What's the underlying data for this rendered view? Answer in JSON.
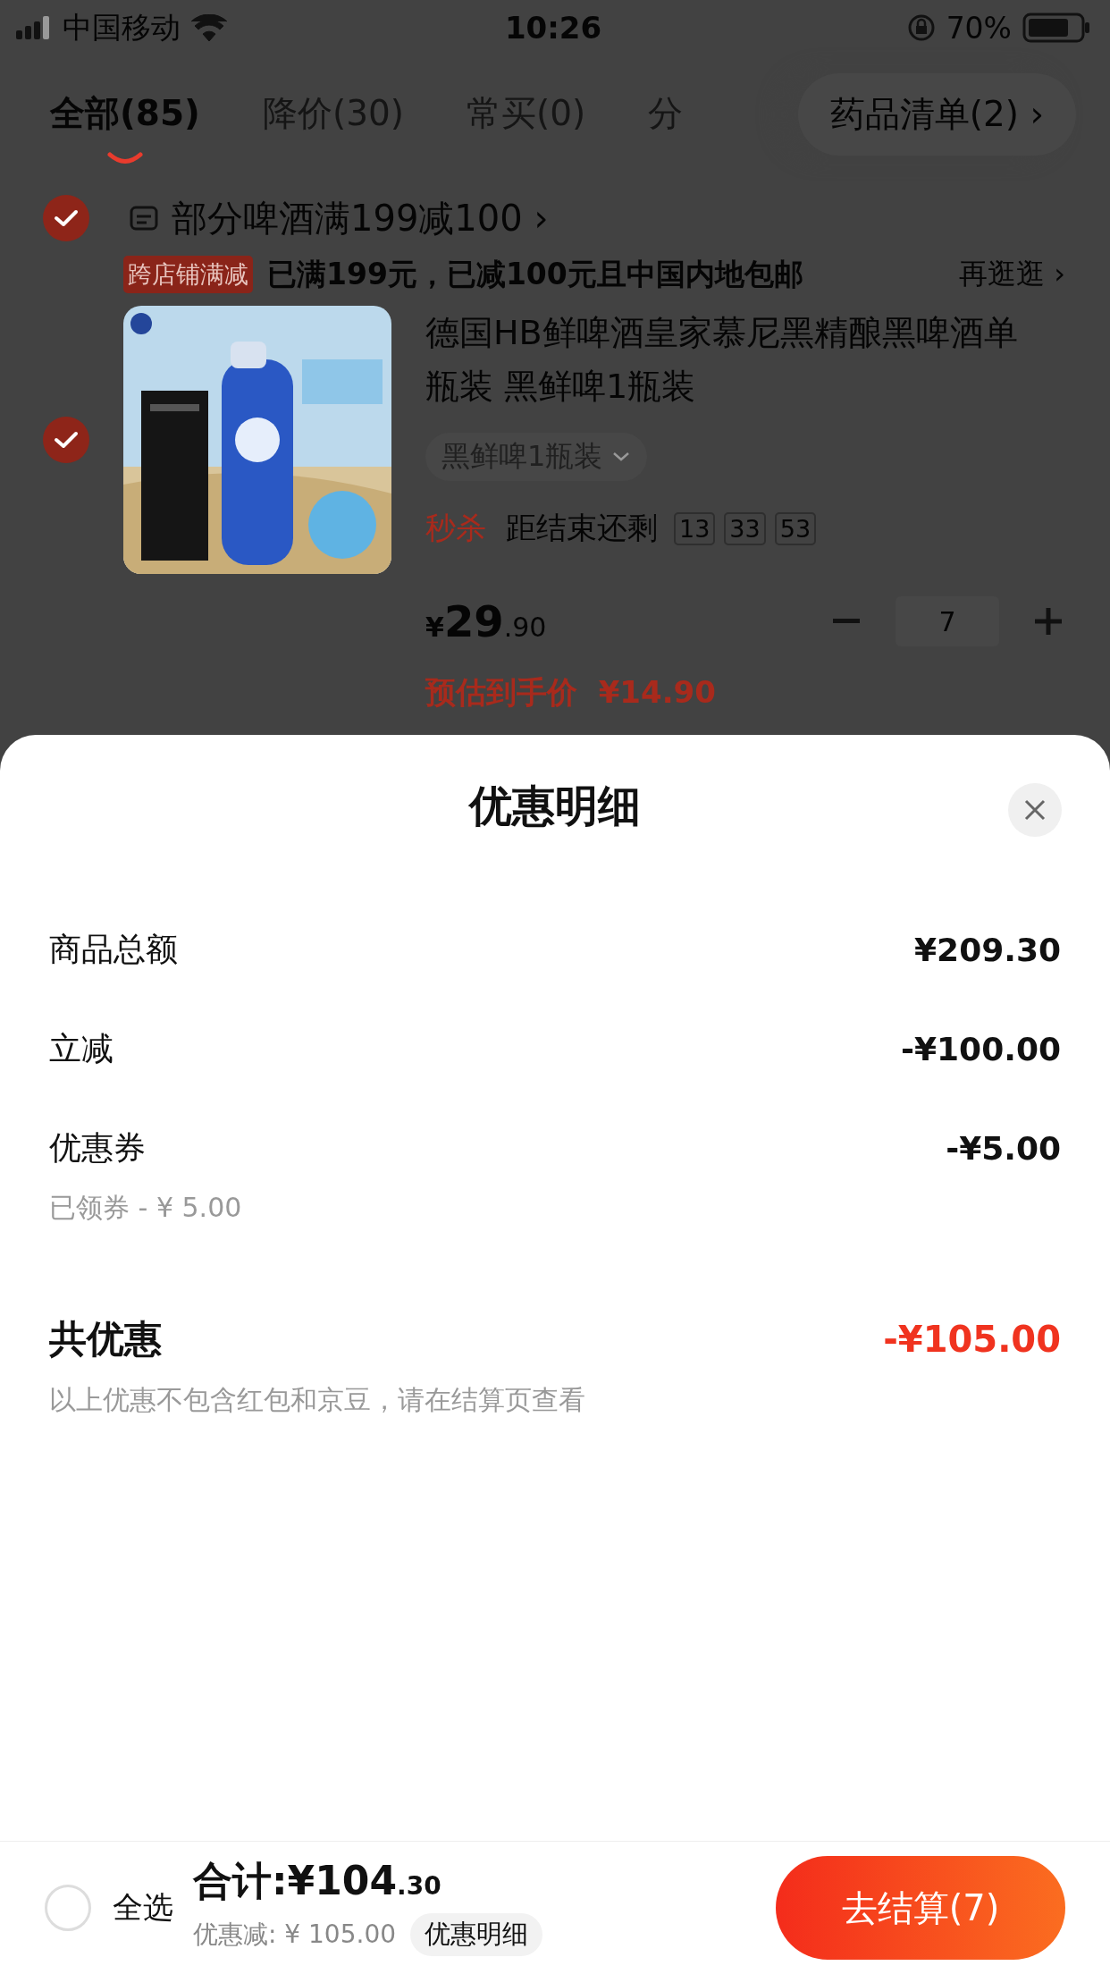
{
  "status_bar": {
    "carrier": "中国移动",
    "time": "10:26",
    "battery": "70%"
  },
  "tabs": [
    {
      "label": "全部(85)",
      "selected": true
    },
    {
      "label": "降价(30)",
      "selected": false
    },
    {
      "label": "常买(0)",
      "selected": false
    },
    {
      "label": "分",
      "selected": false
    }
  ],
  "list_button": {
    "label": "药品清单(2)",
    "chevron": "›"
  },
  "promo": {
    "checked": true,
    "title": "部分啤酒满199减100",
    "chevron": "›",
    "tag": "跨店铺满减",
    "message": "已满199元，已减100元且中国内地包邮",
    "link": "再逛逛 ›"
  },
  "product": {
    "checked": true,
    "title": "德国HB鲜啤酒皇家慕尼黑精酿黑啤酒单瓶装 黑鲜啤1瓶装",
    "variant": "黑鲜啤1瓶装",
    "flash_label": "秒杀",
    "countdown_label": "距结束还剩",
    "countdown": [
      "13",
      "33",
      "53"
    ],
    "price_symbol": "¥",
    "price_integer": "29",
    "price_decimal": ".90",
    "quantity": "7",
    "estimate_label": "预估到手价",
    "estimate": "¥14.90"
  },
  "sheet": {
    "title": "优惠明细",
    "rows": [
      {
        "label": "商品总额",
        "amount": "¥209.30"
      },
      {
        "label": "立减",
        "amount": "-¥100.00"
      },
      {
        "label": "优惠券",
        "amount": "-¥5.00",
        "note": "已领券 - ¥ 5.00"
      }
    ],
    "total": {
      "label": "共优惠",
      "amount": "-¥105.00",
      "note": "以上优惠不包含红包和京豆，请在结算页查看"
    }
  },
  "bottom_bar": {
    "select_all": {
      "label": "全选",
      "checked": false
    },
    "total_label": "合计:¥",
    "total_integer": "104",
    "total_decimal": ".30",
    "discount": "优惠减: ¥ 105.00",
    "details_button": "优惠明细",
    "checkout": "去结算(7)"
  }
}
